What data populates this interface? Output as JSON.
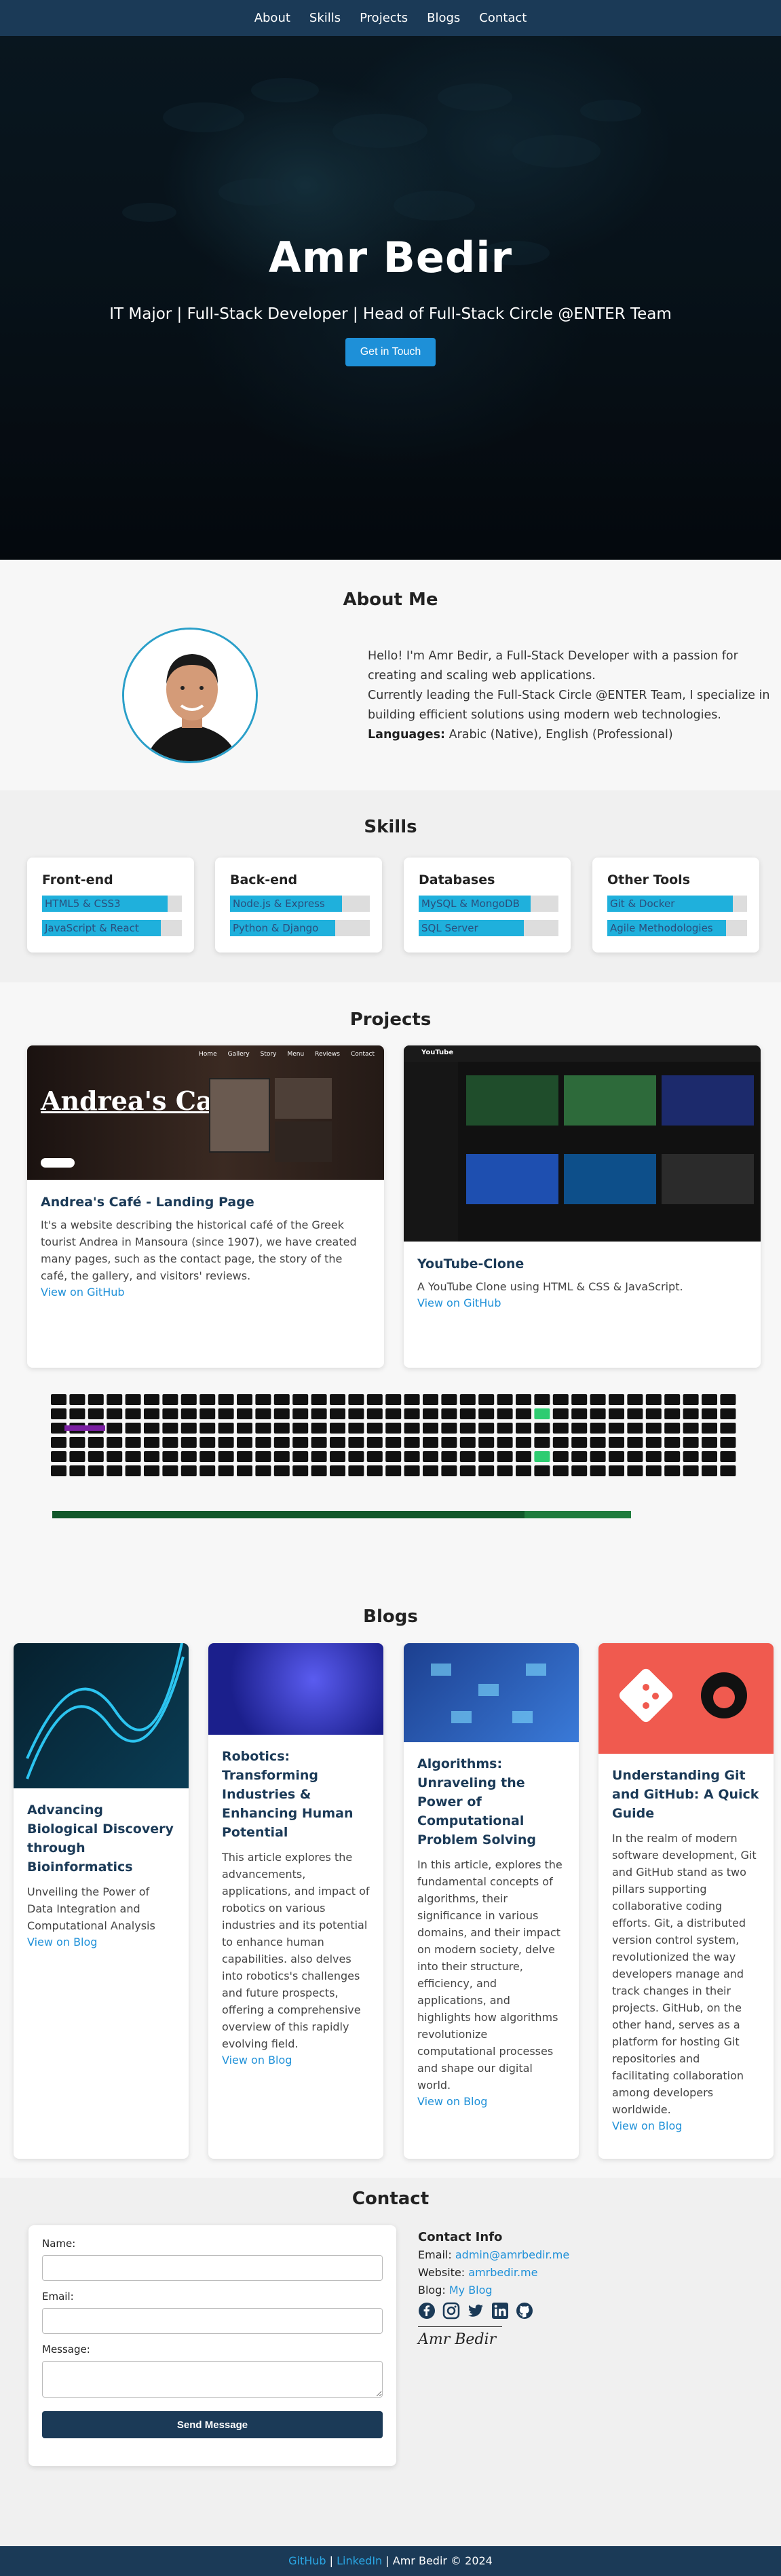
{
  "nav": {
    "items": [
      "About",
      "Skills",
      "Projects",
      "Blogs",
      "Contact"
    ]
  },
  "hero": {
    "name": "Amr Bedir",
    "tagline": "IT Major | Full-Stack Developer | Head of Full-Stack Circle @ENTER Team",
    "cta": "Get in Touch"
  },
  "about": {
    "title": "About Me",
    "line1": "Hello! I'm Amr Bedir, a Full-Stack Developer with a passion for creating and scaling web applications.",
    "line2": "Currently leading the Full-Stack Circle @ENTER Team, I specialize in building efficient solutions using modern web technologies.",
    "languages_label": "Languages:",
    "languages_value": " Arabic (Native), English (Professional)"
  },
  "skills": {
    "title": "Skills",
    "cards": [
      {
        "name": "Front-end",
        "items": [
          {
            "label": "HTML5 & CSS3",
            "level": 0.9
          },
          {
            "label": "JavaScript & React",
            "level": 0.85
          }
        ]
      },
      {
        "name": "Back-end",
        "items": [
          {
            "label": "Node.js & Express",
            "level": 0.8
          },
          {
            "label": "Python & Django",
            "level": 0.75
          }
        ]
      },
      {
        "name": "Databases",
        "items": [
          {
            "label": "MySQL & MongoDB",
            "level": 0.8
          },
          {
            "label": "SQL Server",
            "level": 0.75
          }
        ]
      },
      {
        "name": "Other Tools",
        "items": [
          {
            "label": "Git & Docker",
            "level": 0.9
          },
          {
            "label": "Agile Methodologies",
            "level": 0.85
          }
        ]
      }
    ]
  },
  "projects": {
    "title": "Projects",
    "items": [
      {
        "title": "Andrea's Café - Landing Page",
        "thumb_title": "Andrea's Café",
        "thumb_nav": [
          "Home",
          "Gallery",
          "Story",
          "Menu",
          "Reviews",
          "Contact"
        ],
        "desc": "It's a website describing the historical café of the Greek tourist Andrea in Mansoura (since 1907), we have created many pages, such as the contact page, the story of the café, the gallery, and visitors' reviews.",
        "link": "View on GitHub"
      },
      {
        "title": "YouTube-Clone",
        "thumb_brand": "YouTube",
        "desc": "A YouTube Clone using HTML & CSS & JavaScript.",
        "link": "View on GitHub"
      }
    ]
  },
  "blogs": {
    "title": "Blogs",
    "items": [
      {
        "title": "Advancing Biological Discovery through Bioinformatics",
        "desc": "Unveiling the Power of Data Integration and Computational Analysis",
        "link": "View on Blog"
      },
      {
        "title": "Robotics: Transforming Industries & Enhancing Human Potential",
        "desc": "This article explores the advancements, applications, and impact of robotics on various industries and its potential to enhance human capabilities. also delves into robotics's challenges and future prospects, offering a comprehensive overview of this rapidly evolving field.",
        "link": "View on Blog"
      },
      {
        "title": "Algorithms: Unraveling the Power of Computational Problem Solving",
        "desc": "In this article, explores the fundamental concepts of algorithms, their significance in various domains, and their impact on modern society, delve into their structure, efficiency, and applications, and highlights how algorithms revolutionize computational processes and shape our digital world.",
        "link": "View on Blog"
      },
      {
        "title": "Understanding Git and GitHub: A Quick Guide",
        "desc": "In the realm of modern software development, Git and GitHub stand as two pillars supporting collaborative coding efforts. Git, a distributed version control system, revolutionized the way developers manage and track changes in their projects. GitHub, on the other hand, serves as a platform for hosting Git repositories and facilitating collaboration among developers worldwide.",
        "link": "View on Blog"
      }
    ]
  },
  "contact": {
    "title": "Contact",
    "form": {
      "name_label": "Name:",
      "email_label": "Email:",
      "message_label": "Message:",
      "submit": "Send Message"
    },
    "info": {
      "heading": "Contact Info",
      "email_label": "Email: ",
      "email": "admin@amrbedir.me",
      "website_label": "Website: ",
      "website": "amrbedir.me",
      "blog_label": "Blog: ",
      "blog": "My Blog",
      "signature": "Amr Bedir"
    },
    "social_icons": [
      "facebook-icon",
      "instagram-icon",
      "twitter-icon",
      "linkedin-icon",
      "github-icon"
    ]
  },
  "footer": {
    "github": "GitHub",
    "sep1": " | ",
    "linkedin": "LinkedIn",
    "sep2": " | ",
    "copyright": "Amr Bedir © 2024"
  },
  "colors": {
    "nav": "#1b3a57",
    "accent": "#1e90d8",
    "skill_fill": "#1fb0dc",
    "git": "#f05033"
  }
}
